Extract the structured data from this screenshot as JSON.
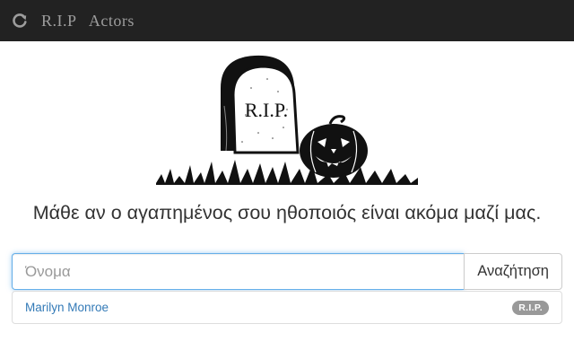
{
  "navbar": {
    "refresh_icon": "refresh-icon",
    "brand": "R.I.P   Actors"
  },
  "hero": {
    "illustration": "tombstone-with-pumpkin",
    "tombstone_text": "R.I.P."
  },
  "tagline": "Μάθε αν ο αγαπημένος σου ηθοποιός είναι ακόμα μαζί μας.",
  "search": {
    "placeholder": "Όνομα",
    "value": "",
    "button_label": "Αναζήτηση",
    "input_focus_color": "#66afe9"
  },
  "results": [
    {
      "name": "Marilyn Monroe",
      "badge": "R.I.P."
    }
  ],
  "colors": {
    "navbar_bg": "#222222",
    "link": "#337ab7",
    "badge_bg": "#999999"
  }
}
